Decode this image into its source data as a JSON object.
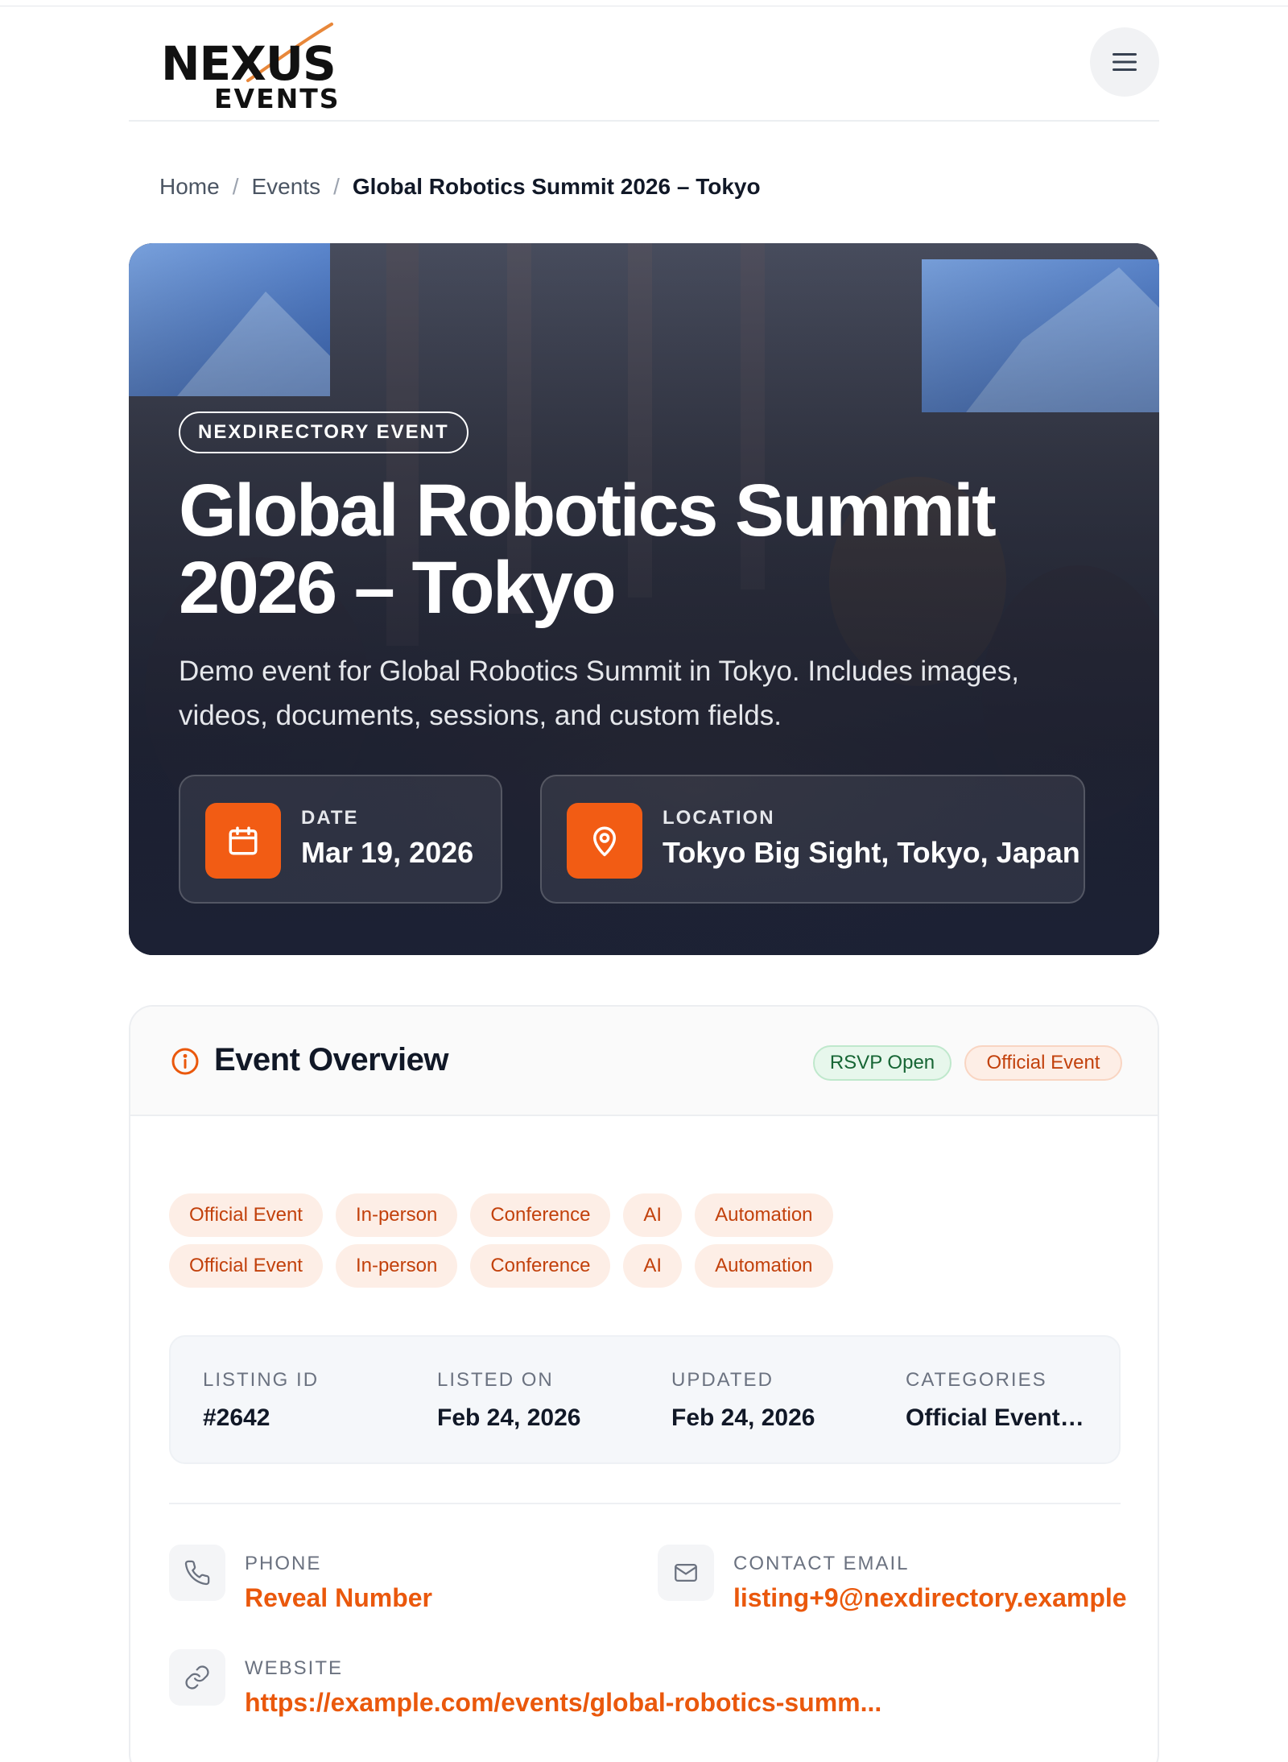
{
  "header": {
    "logo_main": "NEXUS",
    "logo_sub": "EVENTS",
    "menu_icon": "hamburger-menu-icon"
  },
  "breadcrumb": [
    "Home",
    "Events",
    "Global Robotics Summit 2026 – Tokyo"
  ],
  "hero": {
    "badge": "NEXDIRECTORY EVENT",
    "title": "Global Robotics Summit 2026 – Tokyo",
    "description": "Demo event for Global Robotics Summit in Tokyo. Includes images, videos, documents, sessions, and custom fields.",
    "date_label": "DATE",
    "date_value": "Mar 19, 2026",
    "location_label": "LOCATION",
    "location_value": "Tokyo Big Sight, Tokyo, Japan",
    "accent": "#f25c14"
  },
  "overview": {
    "title": "Event Overview",
    "status_badges": [
      "RSVP Open",
      "Official Event"
    ],
    "tag_rows": [
      [
        "Official Event",
        "In-person",
        "Conference",
        "AI",
        "Automation"
      ],
      [
        "Official Event",
        "In-person",
        "Conference",
        "AI",
        "Automation"
      ]
    ],
    "meta": [
      {
        "label": "LISTING ID",
        "value": "#2642"
      },
      {
        "label": "LISTED ON",
        "value": "Feb 24, 2026"
      },
      {
        "label": "UPDATED",
        "value": "Feb 24, 2026"
      },
      {
        "label": "CATEGORIES",
        "value": "Official Event, I..."
      }
    ],
    "phone": {
      "label": "PHONE",
      "value": "Reveal Number"
    },
    "email": {
      "label": "CONTACT EMAIL",
      "value": "listing+9@nexdirectory.example"
    },
    "website": {
      "label": "WEBSITE",
      "value": "https://example.com/events/global-robotics-summ..."
    },
    "link_color": "#ea580c"
  }
}
